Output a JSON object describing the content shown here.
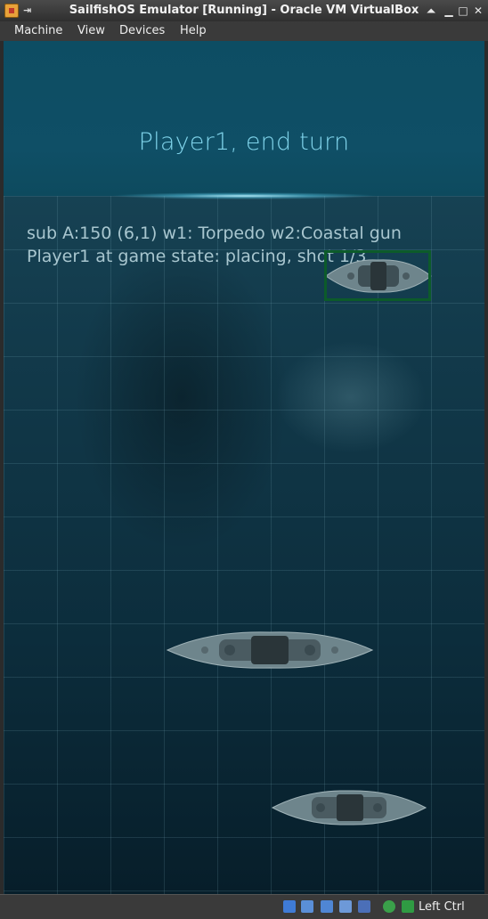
{
  "window": {
    "title": "SailfishOS Emulator [Running] - Oracle VM VirtualBox",
    "controls": {
      "shade": "⏶",
      "minimize": "▁",
      "maximize": "□",
      "close": "✕"
    }
  },
  "menu": [
    "Machine",
    "View",
    "Devices",
    "Help"
  ],
  "game": {
    "header_title": "Player1, end turn",
    "info_line1": "sub A:150 (6,1) w1: Torpedo w2:Coastal gun",
    "info_line2": "Player1 at game state: placing, shot 1/3"
  },
  "statusbar": {
    "icons": [
      "hard-disk-icon",
      "network-icon",
      "shared-folders-icon",
      "display-icon",
      "usb-icon",
      "mouse-integration-icon",
      "keyboard-capture-icon"
    ],
    "host_key": "Left Ctrl"
  },
  "colors": {
    "header_text": "#7fd3ea",
    "info_text": "#a8c6cf",
    "selection_box": "#0c5b2a"
  }
}
